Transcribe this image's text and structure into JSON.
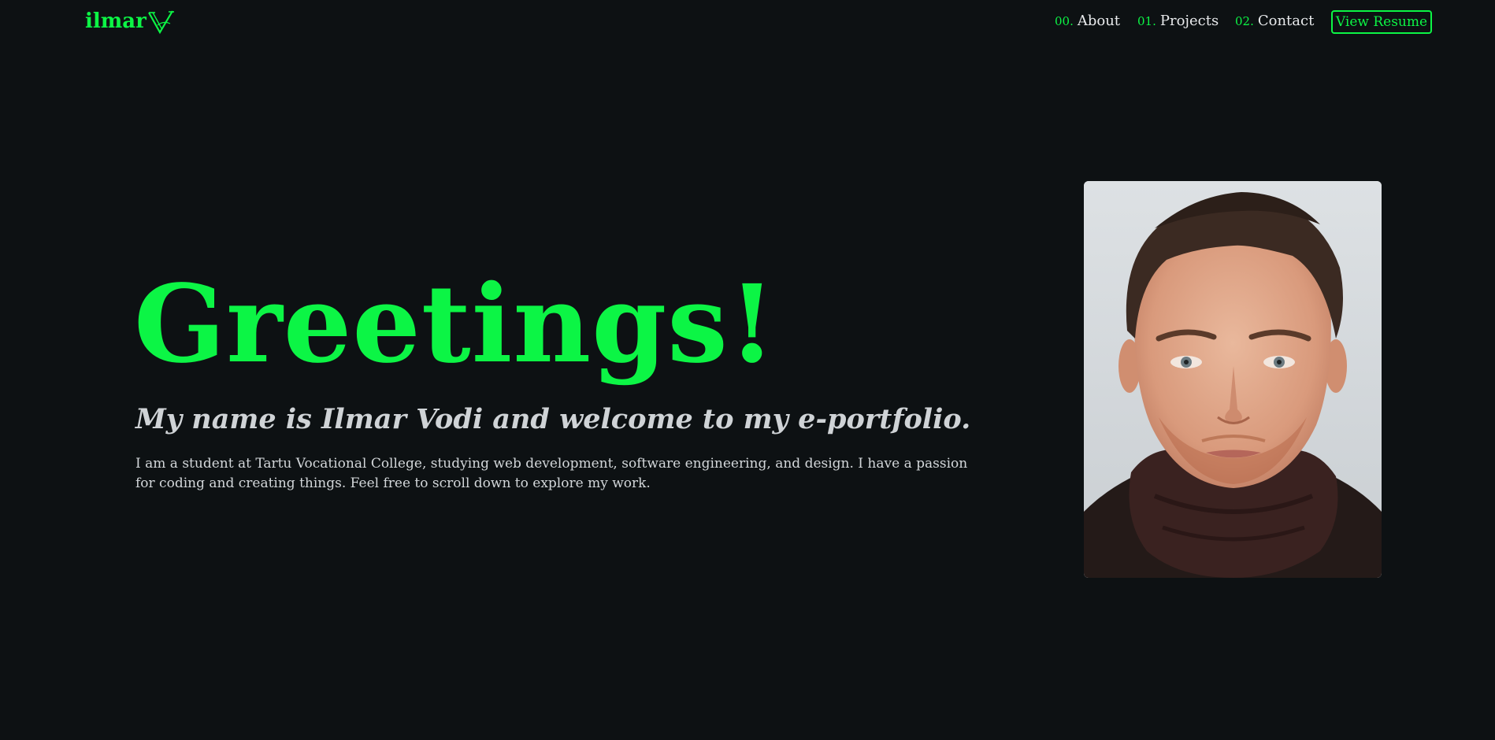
{
  "header": {
    "logo_text": "ilmar",
    "logo_mark_icon": "v-monogram-icon",
    "nav": [
      {
        "num": "00.",
        "label": "About"
      },
      {
        "num": "01.",
        "label": "Projects"
      },
      {
        "num": "02.",
        "label": "Contact"
      }
    ],
    "resume_label": "View Resume"
  },
  "hero": {
    "title": "Greetings!",
    "subtitle": "My name is Ilmar Vodi and welcome to my e-portfolio.",
    "description": "I am a student at Tartu Vocational College, studying web development, software engineering, and design. I have a passion for coding and creating things. Feel free to scroll down to explore my work.",
    "portrait_icon": "portrait-photo"
  },
  "colors": {
    "background": "#0d1113",
    "accent": "#0cf545",
    "text": "#d8dcdf"
  }
}
